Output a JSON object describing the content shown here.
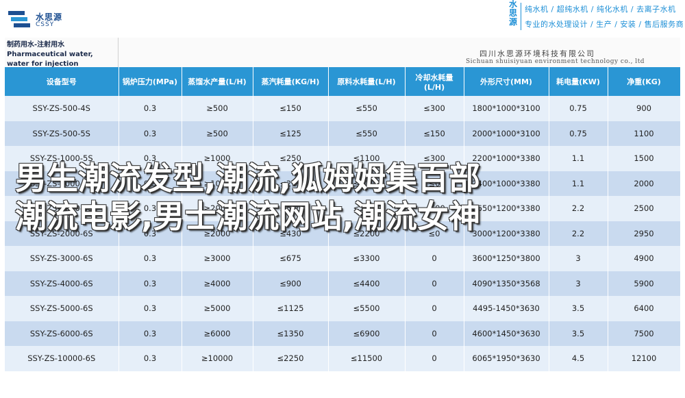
{
  "logo": {
    "name_cn": "水思源",
    "name_en": "CSSY",
    "icon": "water-logo-icon"
  },
  "brand": {
    "vertical_text": "水思源",
    "line1": "纯水机 / 超纯水机 / 纯化水机 / 去离子水机",
    "line2": "专业的水处理设计 / 生产 / 安装 / 售后服务商"
  },
  "sheet": {
    "title": "制药用水-注射用水 Pharmaceutical water, water for injection",
    "company_cn": "四川水思源环境科技有限公司",
    "company_en": "Sichuan shuisiyuan environment technology co., ltd"
  },
  "table": {
    "columns": [
      "设备型号",
      "锅炉压力(MPa)",
      "蒸馏水产量(L/H)",
      "蒸汽耗量(KG/H)",
      "原料水耗量(L/H)",
      "冷却水耗量(L/H)",
      "外形尺寸(MM)",
      "耗电量(KW)",
      "净重(KG)"
    ],
    "rows": [
      [
        "SSY-ZS-500-4S",
        "0.3",
        "≥500",
        "≤150",
        "≤550",
        "≤300",
        "1800*1000*3100",
        "0.75",
        "900"
      ],
      [
        "SSY-ZS-500-5S",
        "0.3",
        "≥500",
        "≤125",
        "≤550",
        "≤150",
        "2000*1000*3100",
        "0.75",
        "1100"
      ],
      [
        "SSY-ZS-1000-5S",
        "0.3",
        "≥1000",
        "≤250",
        "≤1100",
        "≤300",
        "2200*1000*3380",
        "1.1",
        "1500"
      ],
      [
        "SSY-ZS-1000-6S",
        "0.3",
        "≥1000",
        "≤215",
        "≤1100",
        "≤0",
        "2400*1000*3380",
        "1.1",
        "2000"
      ],
      [
        "SSY-ZS-2000-5S",
        "0.3",
        "≥2000",
        "≤500",
        "≤2200",
        "≤600",
        "2650*1200*3380",
        "2.2",
        "2500"
      ],
      [
        "SSY-ZS-2000-6S",
        "0.3",
        "≥2000",
        "≤430",
        "≤2200",
        "≤0",
        "3000*1200*3380",
        "2.2",
        "2950"
      ],
      [
        "SSY-ZS-3000-6S",
        "0.3",
        "≥3000",
        "≤675",
        "≤3300",
        "0",
        "3600*1250*3800",
        "3",
        "4900"
      ],
      [
        "SSY-ZS-4000-6S",
        "0.3",
        "≥4000",
        "≤900",
        "≤4400",
        "0",
        "4090*1350*3568",
        "3",
        "5900"
      ],
      [
        "SSY-ZS-5000-6S",
        "0.3",
        "≥5000",
        "≤1125",
        "≤5500",
        "0",
        "4495-1450*3630",
        "3.5",
        "6400"
      ],
      [
        "SSY-ZS-6000-6S",
        "0.3",
        "≥6000",
        "≤1350",
        "≤6900",
        "0",
        "4600*1450*3630",
        "3.5",
        "7500"
      ],
      [
        "SSY-ZS-10000-6S",
        "0.3",
        "≥10000",
        "≤2250",
        "≤11500",
        "0",
        "6065*1950*3630",
        "4.5",
        "12100"
      ]
    ]
  },
  "overlay": {
    "line1": "男生潮流发型,潮流,狐姆姆集百部",
    "line2": "潮流电影,男士潮流网站,潮流女神"
  }
}
